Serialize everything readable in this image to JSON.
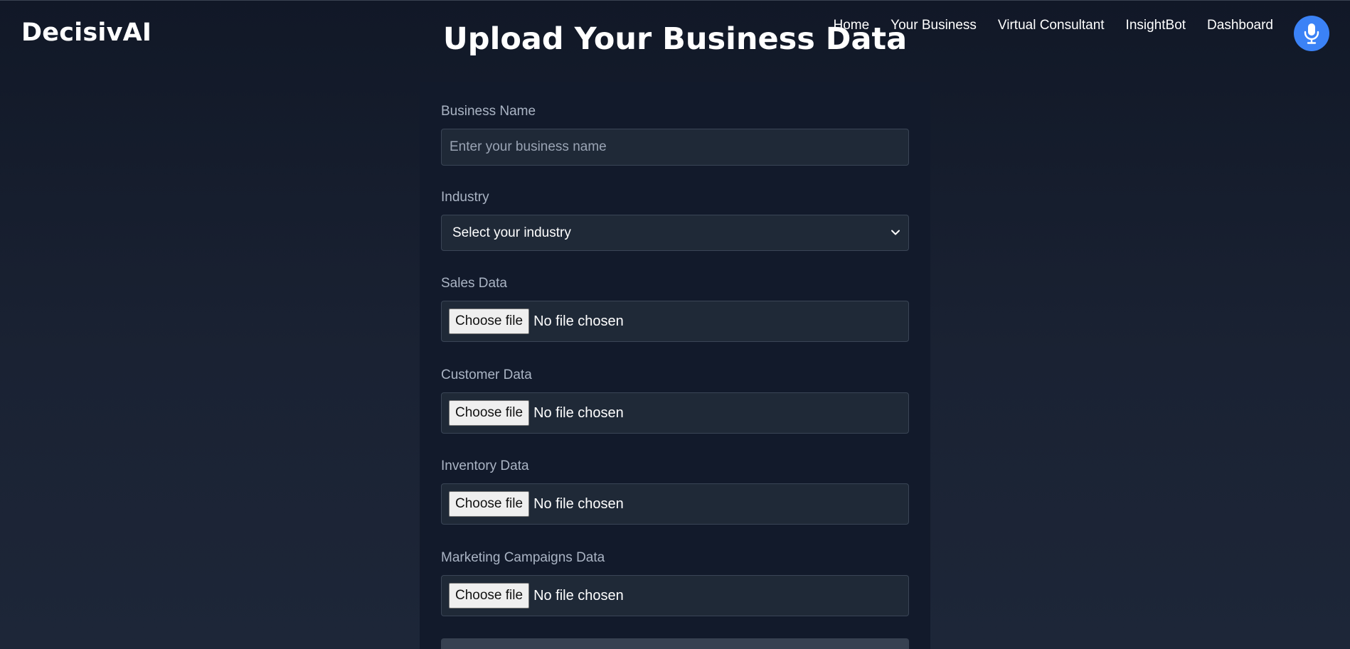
{
  "brand": "DecisivAI",
  "page_title": "Upload Your Business Data",
  "nav": {
    "items": [
      "Home",
      "Your Business",
      "Virtual Consultant",
      "InsightBot",
      "Dashboard"
    ],
    "mic_icon": "microphone-icon"
  },
  "form": {
    "business_name": {
      "label": "Business Name",
      "placeholder": "Enter your business name",
      "value": ""
    },
    "industry": {
      "label": "Industry",
      "selected": "Select your industry"
    },
    "files": [
      {
        "label": "Sales Data",
        "button": "Choose file",
        "status": "No file chosen"
      },
      {
        "label": "Customer Data",
        "button": "Choose file",
        "status": "No file chosen"
      },
      {
        "label": "Inventory Data",
        "button": "Choose file",
        "status": "No file chosen"
      },
      {
        "label": "Marketing Campaigns Data",
        "button": "Choose file",
        "status": "No file chosen"
      }
    ]
  },
  "colors": {
    "background": "#111827",
    "card": "#121a2b",
    "input_bg": "#1f2937",
    "accent": "#3b82f6",
    "label": "#aab4c4"
  }
}
